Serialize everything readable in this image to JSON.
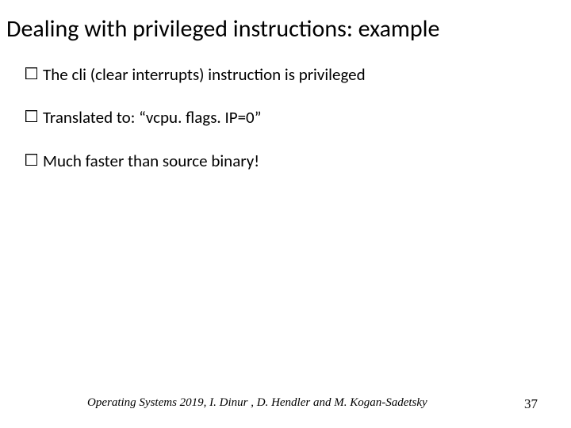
{
  "title": "Dealing with privileged instructions: example",
  "bullets": [
    "The cli (clear interrupts) instruction is privileged",
    "Translated to: “vcpu. flags. IP=0”",
    "Much faster than source binary!"
  ],
  "footer": {
    "credit": "Operating Systems 2019, I. Dinur , D. Hendler and M. Kogan-Sadetsky",
    "page": "37"
  }
}
